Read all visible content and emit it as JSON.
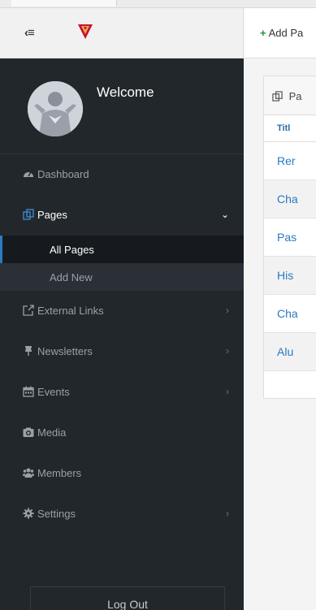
{
  "header": {
    "toggle_icon": "sidebar-collapse-icon",
    "toggle_glyph": "‹≡",
    "logo_icon": "shield-logo-icon",
    "add_page_label": "Add Pa",
    "add_page_icon": "plus-icon",
    "add_page_glyph": "+"
  },
  "sidebar": {
    "welcome": "Welcome",
    "menu": [
      {
        "id": "dashboard",
        "label": "Dashboard",
        "icon": "dashboard-icon",
        "chevron": ""
      },
      {
        "id": "pages",
        "label": "Pages",
        "icon": "pages-icon",
        "chevron": "⌄"
      },
      {
        "id": "external-links",
        "label": "External Links",
        "icon": "external-link-icon",
        "chevron": "›"
      },
      {
        "id": "newsletters",
        "label": "Newsletters",
        "icon": "pin-icon",
        "chevron": "›"
      },
      {
        "id": "events",
        "label": "Events",
        "icon": "calendar-icon",
        "chevron": "›"
      },
      {
        "id": "media",
        "label": "Media",
        "icon": "camera-icon",
        "chevron": ""
      },
      {
        "id": "members",
        "label": "Members",
        "icon": "users-icon",
        "chevron": ""
      },
      {
        "id": "settings",
        "label": "Settings",
        "icon": "gear-icon",
        "chevron": "›"
      }
    ],
    "submenu": [
      {
        "label": "All Pages",
        "current": true
      },
      {
        "label": "Add New",
        "current": false
      }
    ],
    "logout_label": "Log Out"
  },
  "panel": {
    "title": "Pa",
    "title_icon": "pages-icon",
    "column_title": "Titl",
    "rows": [
      "Rer",
      "Cha",
      "Pas",
      "His",
      "Cha",
      "Alu"
    ]
  },
  "colors": {
    "sidebar_bg": "#22272c",
    "active_indicator": "#2b7ac4",
    "link_blue": "#2a78c2",
    "add_green": "#1c9a3a"
  }
}
